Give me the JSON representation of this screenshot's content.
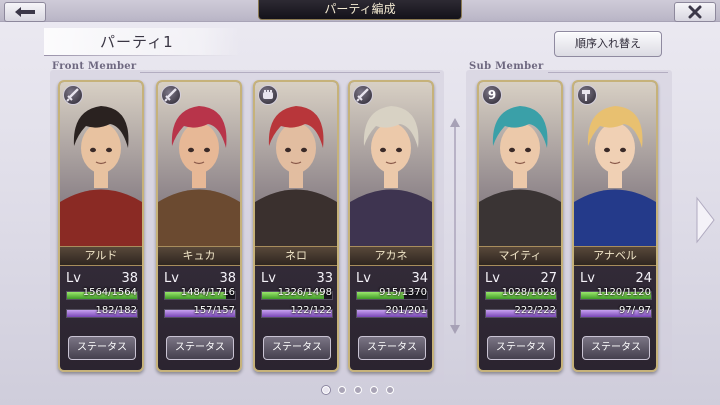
{
  "header": {
    "title": "パーティ編成",
    "back_icon": "left-arrow-icon",
    "close_icon": "close-icon"
  },
  "party": {
    "name": "パーティ1",
    "reorder_label": "順序入れ替え"
  },
  "sections": {
    "front_label": "Front Member",
    "sub_label": "Sub Member"
  },
  "status_label": "ステータス",
  "level_label": "Lv",
  "front_members": [
    {
      "name": "アルド",
      "level": "38",
      "hp": "1564/1564",
      "mp": "182/182",
      "hp_ratio": 1.0,
      "mp_ratio": 1.0,
      "weapon_icon": "sword-icon",
      "hair": "#2a2220",
      "skin": "#e8c2a0",
      "outfit": "#8a2a24"
    },
    {
      "name": "キュカ",
      "level": "38",
      "hp": "1484/1716",
      "mp": "157/157",
      "hp_ratio": 0.865,
      "mp_ratio": 1.0,
      "weapon_icon": "sword-icon",
      "hair": "#b8344a",
      "skin": "#e7b896",
      "outfit": "#6b4a30"
    },
    {
      "name": "ネロ",
      "level": "33",
      "hp": "1326/1498",
      "mp": "122/122",
      "hp_ratio": 0.885,
      "mp_ratio": 1.0,
      "weapon_icon": "fist-icon",
      "hair": "#b8363a",
      "skin": "#e2bda0",
      "outfit": "#3a302e"
    },
    {
      "name": "アカネ",
      "level": "34",
      "hp": "915/1370",
      "mp": "201/201",
      "hp_ratio": 0.668,
      "mp_ratio": 1.0,
      "weapon_icon": "sword-icon",
      "hair": "#d8d2c4",
      "skin": "#ecc9aa",
      "outfit": "#3e3450"
    }
  ],
  "sub_members": [
    {
      "name": "マイティ",
      "level": "27",
      "hp": "1028/1028",
      "mp": "222/222",
      "hp_ratio": 1.0,
      "mp_ratio": 1.0,
      "weapon_icon": "number-9-icon",
      "badge_text": "9",
      "hair": "#3aa0a8",
      "skin": "#ecc9aa",
      "outfit": "#3a3434"
    },
    {
      "name": "アナベル",
      "level": "24",
      "hp": "1120/1120",
      "mp": "97/ 97",
      "hp_ratio": 1.0,
      "mp_ratio": 1.0,
      "weapon_icon": "hammer-icon",
      "hair": "#e8c070",
      "skin": "#f0d0b4",
      "outfit": "#243a8a"
    }
  ],
  "pagination": {
    "pages": 5,
    "current": 1
  },
  "colors": {
    "hp": "#5cc23a",
    "mp": "#9a6ad6",
    "card_border": "#c6b27a"
  }
}
